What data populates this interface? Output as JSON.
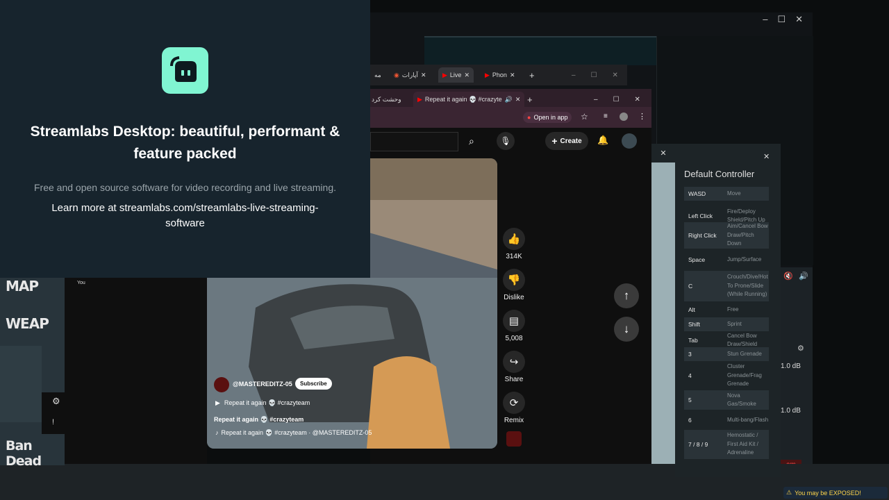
{
  "window_controls": {
    "min": "–",
    "max": "☐",
    "close": "✕"
  },
  "streamlabs": {
    "title": "Streamlabs Desktop: beautiful, performant & feature packed",
    "subtitle": "Free and open source software for video recording and live streaming.",
    "learn_more": "Learn more at streamlabs.com/streamlabs-live-streaming-software"
  },
  "browser_back": {
    "tabs": [
      {
        "label": "مه"
      },
      {
        "label": "آپارات"
      },
      {
        "label": "Live"
      },
      {
        "label": "Phon"
      }
    ]
  },
  "browser_front": {
    "tabs": [
      {
        "label": "وحشت كرد"
      },
      {
        "label": "Repeat it again 💀 #crazyte"
      }
    ],
    "open_in_app": "Open in app",
    "create_label": "Create"
  },
  "youtube": {
    "left_label": "You",
    "channel": "@MASTEREDITZ-05",
    "subscribe": "Subscribe",
    "title_line": "Repeat it again 💀 #crazyteam",
    "description": "Repeat it again 💀 #crazyteam",
    "sound": "Repeat it again 💀 #crazyteam · @MASTEREDITZ-05",
    "likes": "314K",
    "dislike": "Dislike",
    "comments": "5,008",
    "share": "Share",
    "remix": "Remix"
  },
  "game": {
    "map_label": "MAP",
    "weapon_label": "WEAP",
    "footer_label": "Ban Dead"
  },
  "controller": {
    "title": "Default Controller",
    "rows": [
      {
        "key": "WASD",
        "action": "Move"
      },
      {
        "key": "Left Click",
        "action": "Fire/Deploy Shield/Pitch Up"
      },
      {
        "key": "Right Click",
        "action": "Aim/Cancel Bow Draw/Pitch Down"
      },
      {
        "key": "Space",
        "action": "Jump/Surface"
      },
      {
        "key": "C",
        "action": "Crouch/Dive/Hot To Prone/Slide (While Running)"
      },
      {
        "key": "Alt",
        "action": "Free"
      },
      {
        "key": "Shift",
        "action": "Sprint"
      },
      {
        "key": "Tab",
        "action": "Cancel Bow Draw/Shield"
      },
      {
        "key": "3",
        "action": "Stun Grenade"
      },
      {
        "key": "4",
        "action": "Cluster Grenade/Frag Grenade"
      },
      {
        "key": "5",
        "action": "Nova Gas/Smoke"
      },
      {
        "key": "6",
        "action": "Multi-bang/Flash"
      },
      {
        "key": "7 / 8 / 9",
        "action": "Hemostatic / First Aid Kit / Adrenaline"
      }
    ]
  },
  "mixer": {
    "db1": "1.0 dB",
    "db2": "1.0 dB",
    "red_btn": "am"
  },
  "toast": {
    "text": "You may be EXPOSED!"
  },
  "colors": {
    "accent": "#80f5d2",
    "yt_red": "#ff0000",
    "panel": "#1d2427"
  }
}
